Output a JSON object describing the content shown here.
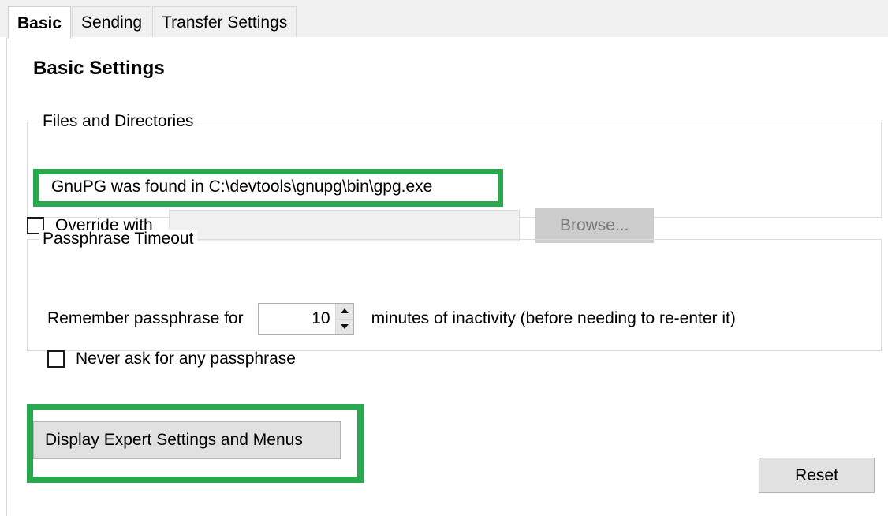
{
  "tabs": [
    {
      "label": "Basic",
      "selected": true
    },
    {
      "label": "Sending",
      "selected": false
    },
    {
      "label": "Transfer Settings",
      "selected": false
    }
  ],
  "page": {
    "title": "Basic Settings"
  },
  "files_group": {
    "legend": "Files and Directories",
    "found_path_text": "GnuPG was found in C:\\devtools\\gnupg\\bin\\gpg.exe",
    "override_checkbox_label": "Override with",
    "override_path_value": "",
    "override_path_placeholder": "",
    "browse_label": "Browse..."
  },
  "passphrase_group": {
    "legend": "Passphrase Timeout",
    "remember_label": "Remember passphrase for",
    "timeout_minutes": "10",
    "remember_suffix": "minutes of inactivity (before needing to re-enter it)",
    "never_ask_label": "Never ask for any passphrase"
  },
  "expert_button_label": "Display Expert Settings and Menus",
  "reset_button_label": "Reset",
  "annotations": {
    "highlight_color": "#2aa84f"
  }
}
